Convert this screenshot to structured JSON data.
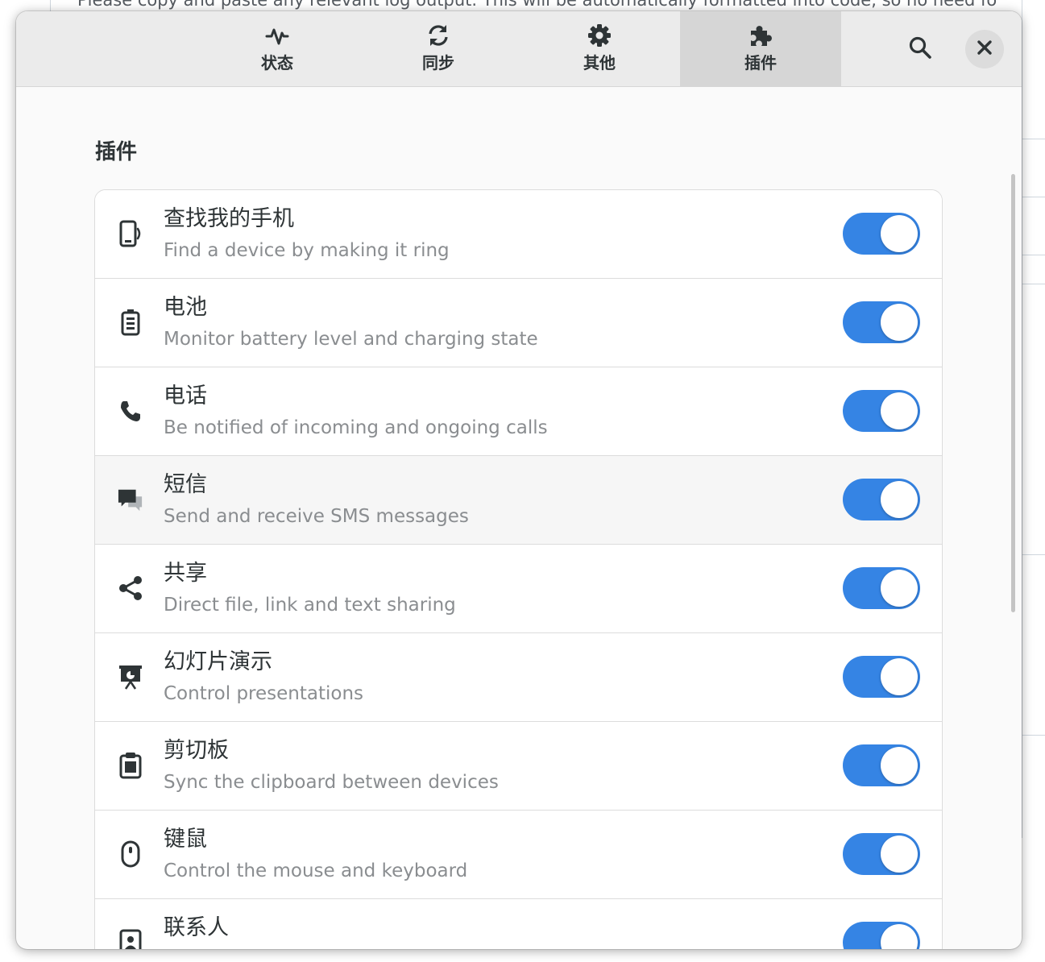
{
  "background_page": {
    "text": "Please copy and paste any relevant log output. This will be automatically formatted into code, so no need fo"
  },
  "header": {
    "tabs": [
      {
        "label": "状态",
        "icon": "activity-icon",
        "active": false
      },
      {
        "label": "同步",
        "icon": "sync-icon",
        "active": false
      },
      {
        "label": "其他",
        "icon": "gear-icon",
        "active": false
      },
      {
        "label": "插件",
        "icon": "puzzle-icon",
        "active": true
      }
    ],
    "search_icon": "search-icon",
    "close_icon": "close-icon"
  },
  "section": {
    "title": "插件"
  },
  "plugins": [
    {
      "title": "查找我的手机",
      "subtitle": "Find a device by making it ring",
      "icon": "find-phone-icon",
      "enabled": true
    },
    {
      "title": "电池",
      "subtitle": "Monitor battery level and charging state",
      "icon": "battery-icon",
      "enabled": true
    },
    {
      "title": "电话",
      "subtitle": "Be notified of incoming and ongoing calls",
      "icon": "phone-icon",
      "enabled": true
    },
    {
      "title": "短信",
      "subtitle": "Send and receive SMS messages",
      "icon": "chat-icon",
      "enabled": true
    },
    {
      "title": "共享",
      "subtitle": "Direct file, link and text sharing",
      "icon": "share-icon",
      "enabled": true
    },
    {
      "title": "幻灯片演示",
      "subtitle": "Control presentations",
      "icon": "presentation-icon",
      "enabled": true
    },
    {
      "title": "剪切板",
      "subtitle": "Sync the clipboard between devices",
      "icon": "clipboard-icon",
      "enabled": true
    },
    {
      "title": "键鼠",
      "subtitle": "Control the mouse and keyboard",
      "icon": "mouse-icon",
      "enabled": true
    },
    {
      "title": "联系人",
      "subtitle": "",
      "icon": "contacts-icon",
      "enabled": true
    }
  ],
  "colors": {
    "accent": "#3584e4",
    "headerbar": "#ebebeb",
    "active_tab": "#d6d6d6",
    "text": "#2e3436",
    "subtitle": "#8a8d90"
  }
}
